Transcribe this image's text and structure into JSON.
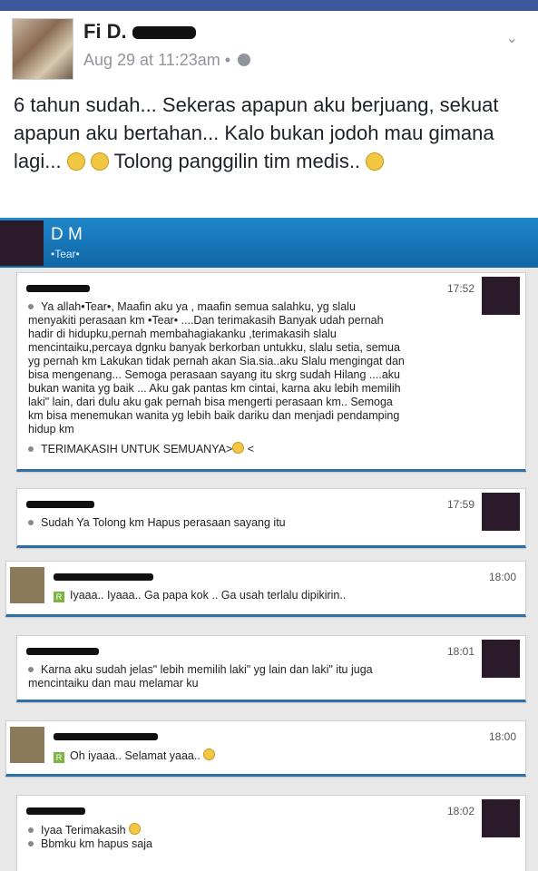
{
  "post": {
    "author": "Fi D.",
    "timestamp": "Aug 29 at 11:23am",
    "separator": "•",
    "text": "6 tahun sudah... Sekeras apapun aku berjuang, sekuat apapun aku bertahan... Kalo bukan jodoh mau gimana lagi...",
    "text2": "Tolong panggilin tim medis..",
    "chevron": "⌄"
  },
  "chat": {
    "contact_name": "D     M",
    "contact_status": "•Tear•",
    "messages": [
      {
        "time": "17:52",
        "lines": [
          "Ya allah•Tear•, Maafin aku ya     , maafin semua salahku, yg slalu",
          "menyakiti perasaan km •Tear• ....Dan terimakasih Banyak udah pernah",
          "hadir di hidupku,pernah membahagiakanku ,terimakasih slalu",
          "mencintaiku,percaya dgnku banyak berkorban untukku, slalu setia, semua",
          "yg pernah km Lakukan tidak pernah akan Sia.sia..aku Slalu mengingat dan",
          "bisa mengenang... Semoga perasaan sayang itu skrg sudah Hilang ....aku",
          "bukan wanita yg baik ... Aku gak pantas km cintai, karna aku lebih memilih",
          "laki\" lain, dari dulu aku gak pernah bisa mengerti perasaan km.. Semoga",
          "km bisa menemukan wanita yg lebih baik dariku dan menjadi pendamping",
          "hidup km"
        ],
        "line2": "TERIMAKASIH UNTUK SEMUANYA>",
        "line2_suffix": "<"
      },
      {
        "time": "17:59",
        "line": "Sudah Ya      Tolong km Hapus perasaan sayang itu"
      },
      {
        "time": "18:00",
        "line": "Iyaaa.. Iyaaa.. Ga papa kok      .. Ga usah terlalu dipikirin.."
      },
      {
        "time": "18:01",
        "lines": [
          "Karna aku sudah jelas\" lebih memilih laki\" yg lain dan laki\" itu juga",
          "mencintaiku dan mau melamar ku"
        ]
      },
      {
        "time": "18:00",
        "line": "Oh iyaaa.. Selamat yaaa.."
      },
      {
        "time": "18:02",
        "lines": [
          "Iyaa Terimakasih",
          "Bbmku km hapus saja"
        ]
      }
    ],
    "badge": "R"
  },
  "colors": {
    "facebook_blue": "#3b5998",
    "bbm_blue": "#1a7bbf"
  }
}
